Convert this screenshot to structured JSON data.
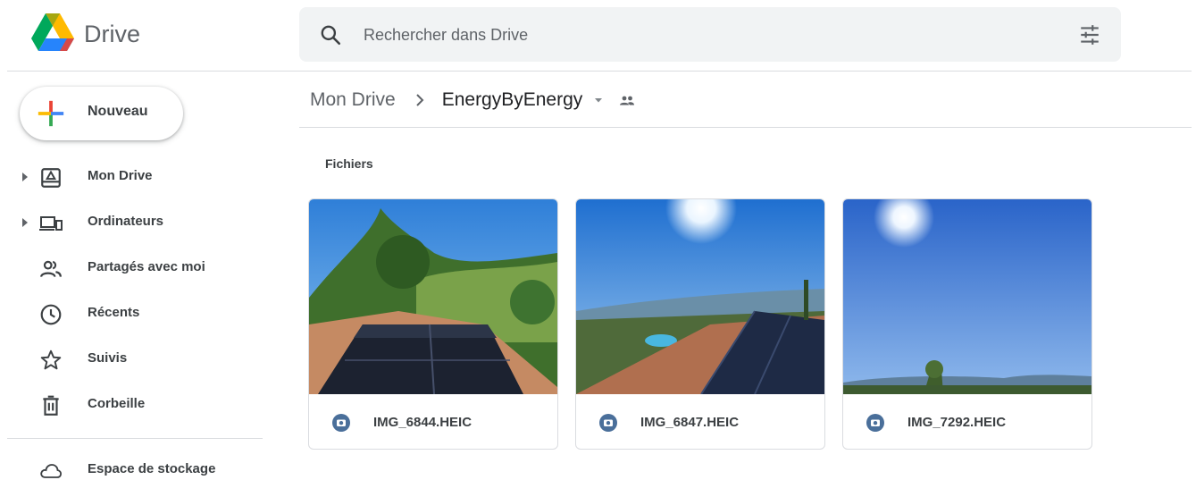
{
  "header": {
    "app_title": "Drive",
    "search_placeholder": "Rechercher dans Drive",
    "icons": {
      "logo": "drive-logo-icon",
      "search": "search-icon",
      "filters": "tune-icon"
    }
  },
  "sidebar": {
    "new_button": "Nouveau",
    "items": [
      {
        "label": "Mon Drive",
        "icon": "drive-icon",
        "expandable": true
      },
      {
        "label": "Ordinateurs",
        "icon": "computers-icon",
        "expandable": true
      },
      {
        "label": "Partagés avec moi",
        "icon": "shared-people-icon",
        "expandable": false
      },
      {
        "label": "Récents",
        "icon": "clock-icon",
        "expandable": false
      },
      {
        "label": "Suivis",
        "icon": "star-icon",
        "expandable": false
      },
      {
        "label": "Corbeille",
        "icon": "trash-icon",
        "expandable": false
      }
    ],
    "storage": {
      "label": "Espace de stockage",
      "icon": "cloud-icon"
    }
  },
  "breadcrumb": {
    "root": "Mon Drive",
    "current": "EnergyByEnergy"
  },
  "main": {
    "section_title": "Fichiers",
    "files": [
      {
        "name": "IMG_6844.HEIC",
        "icon": "photo-icon"
      },
      {
        "name": "IMG_6847.HEIC",
        "icon": "photo-icon"
      },
      {
        "name": "IMG_7292.HEIC",
        "icon": "photo-icon"
      }
    ]
  },
  "colors": {
    "accent_blue": "#1a73e8",
    "photo_icon": "#4a6f9a",
    "search_bg": "#f1f3f4",
    "divider": "#dadce0"
  }
}
